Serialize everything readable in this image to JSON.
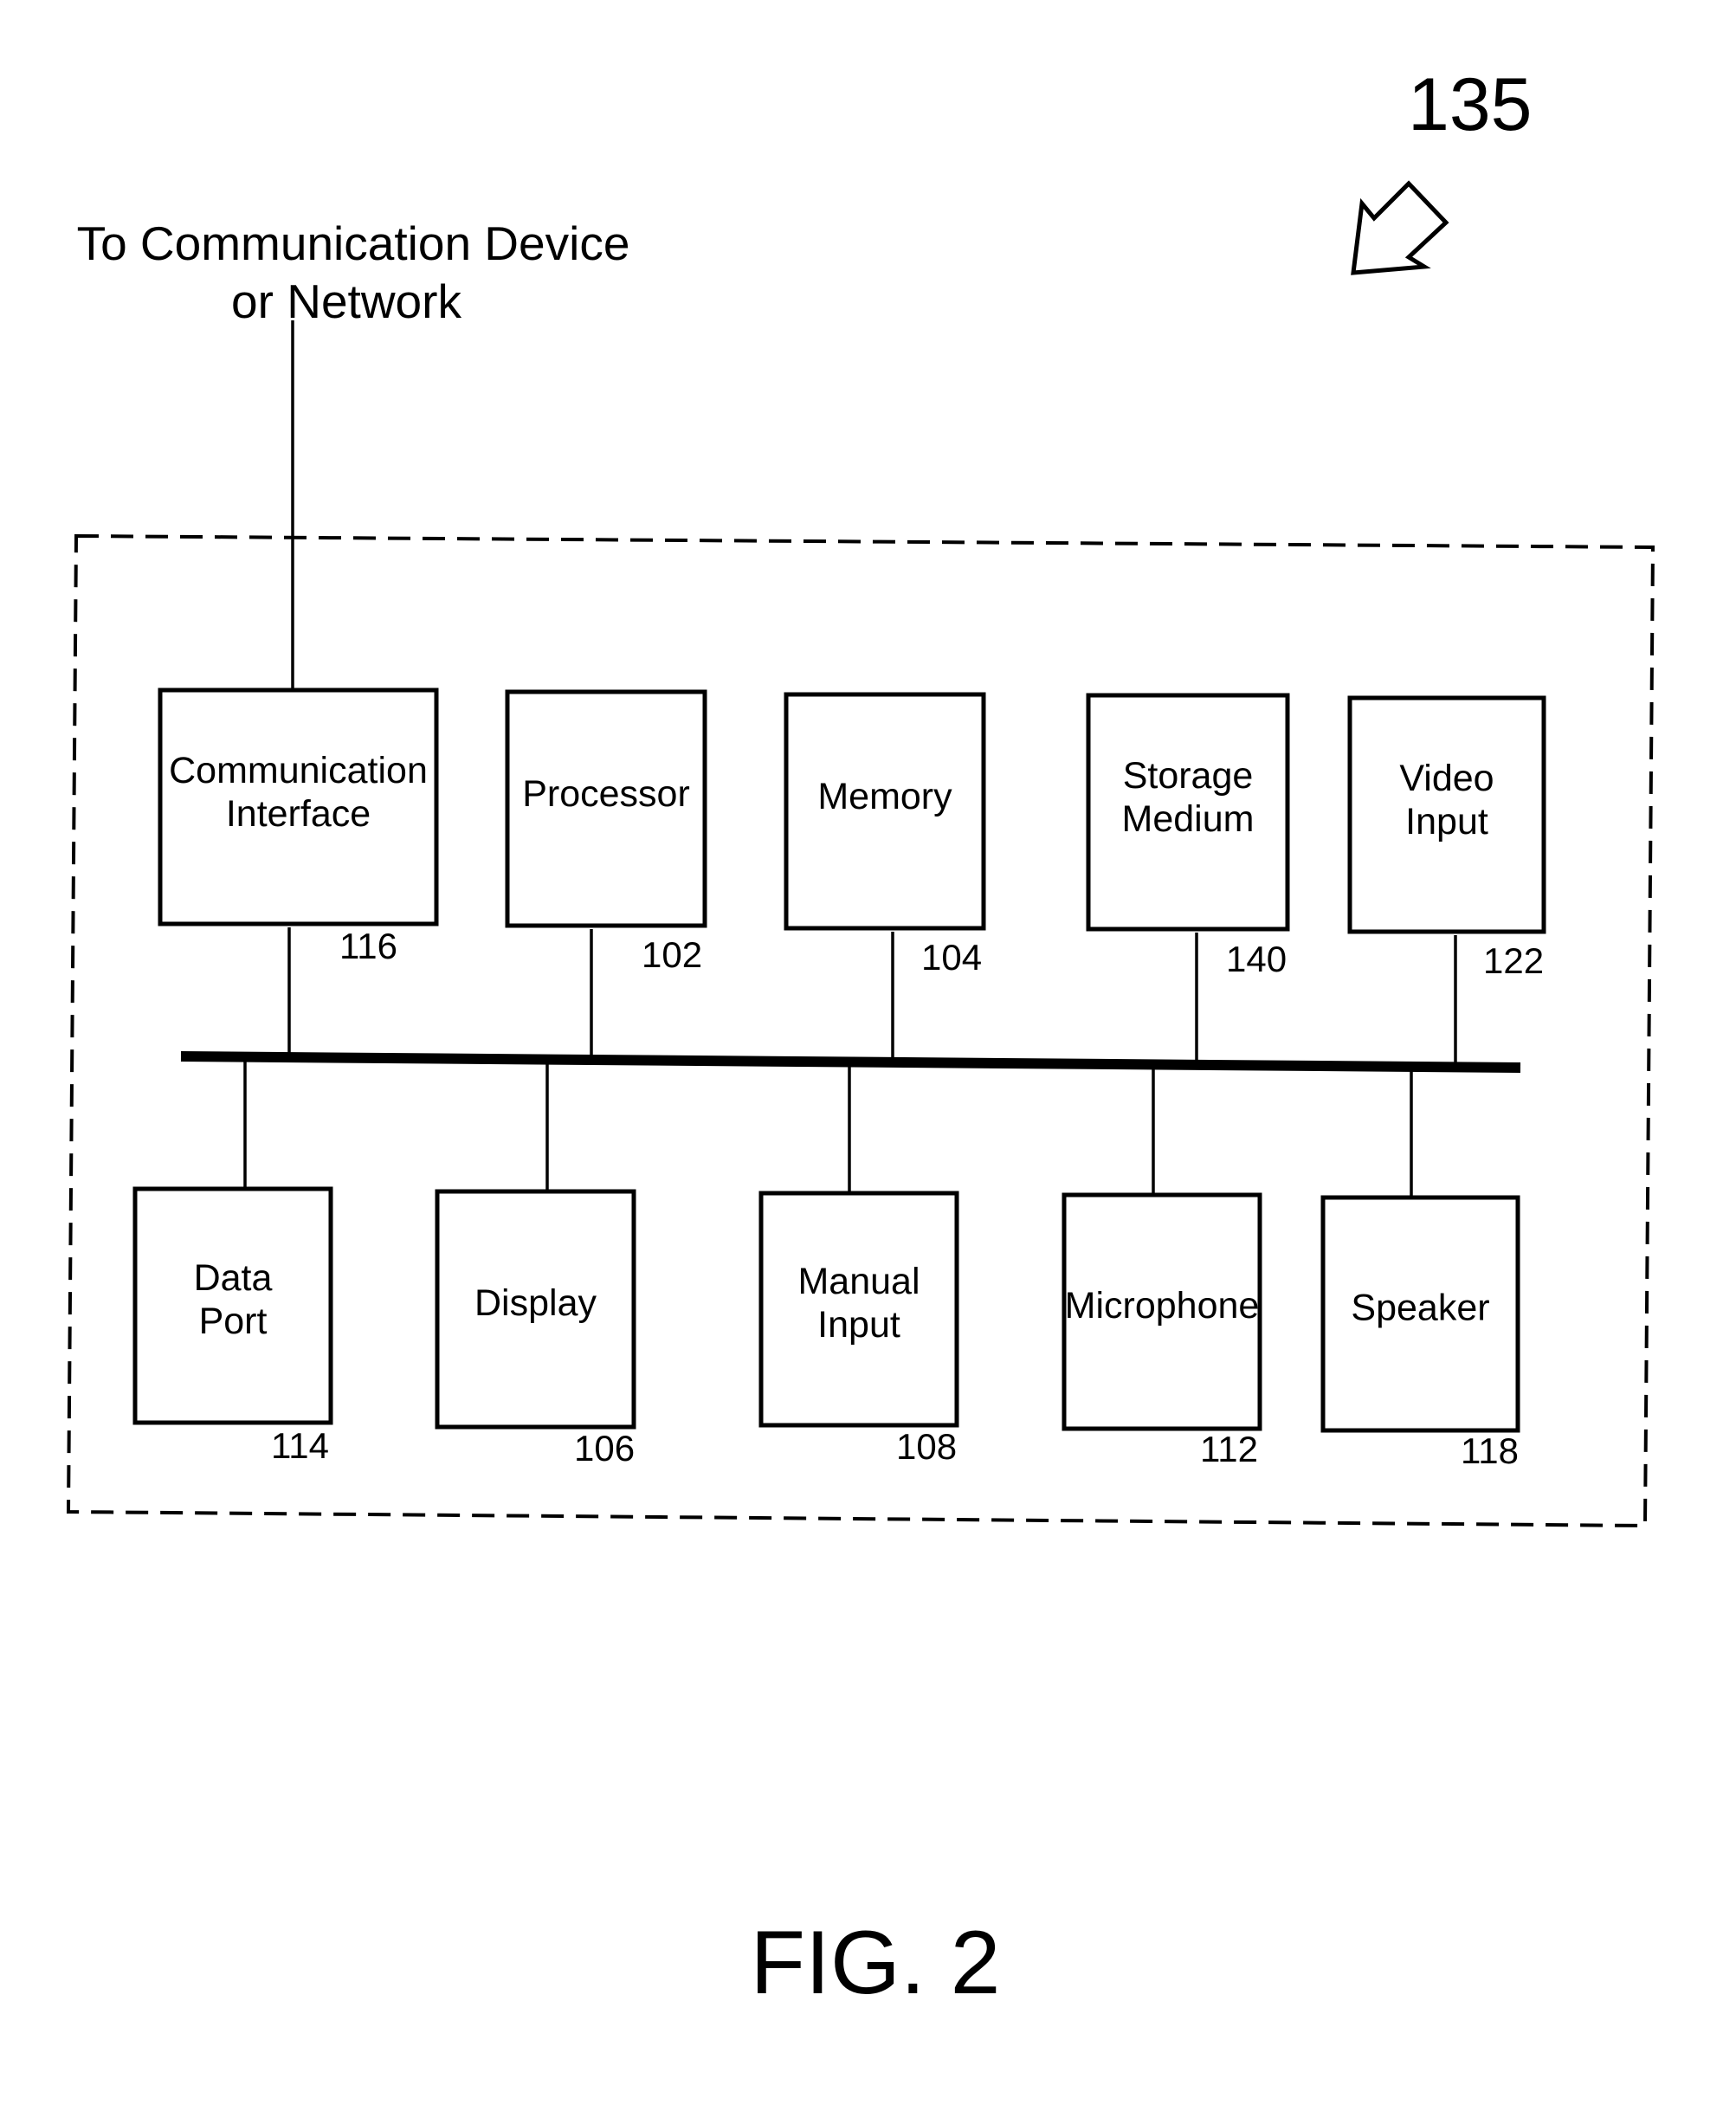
{
  "figure": {
    "reference_numeral": "135",
    "caption": "FIG. 2",
    "external_connection_label": [
      "To Communication Device",
      "or Network"
    ]
  },
  "top_row": [
    {
      "id": "communication-interface",
      "lines": [
        "Communication",
        "Interface"
      ],
      "ref": "116"
    },
    {
      "id": "processor",
      "lines": [
        "Processor"
      ],
      "ref": "102"
    },
    {
      "id": "memory",
      "lines": [
        "Memory"
      ],
      "ref": "104"
    },
    {
      "id": "storage-medium",
      "lines": [
        "Storage",
        "Medium"
      ],
      "ref": "140"
    },
    {
      "id": "video-input",
      "lines": [
        "Video",
        "Input"
      ],
      "ref": "122"
    }
  ],
  "bottom_row": [
    {
      "id": "data-port",
      "lines": [
        "Data",
        "Port"
      ],
      "ref": "114"
    },
    {
      "id": "display",
      "lines": [
        "Display"
      ],
      "ref": "106"
    },
    {
      "id": "manual-input",
      "lines": [
        "Manual",
        "Input"
      ],
      "ref": "108"
    },
    {
      "id": "microphone",
      "lines": [
        "Microphone"
      ],
      "ref": "112"
    },
    {
      "id": "speaker",
      "lines": [
        "Speaker"
      ],
      "ref": "118"
    }
  ],
  "connections": {
    "bus": "shared system bus",
    "external_link_from": "communication-interface"
  }
}
